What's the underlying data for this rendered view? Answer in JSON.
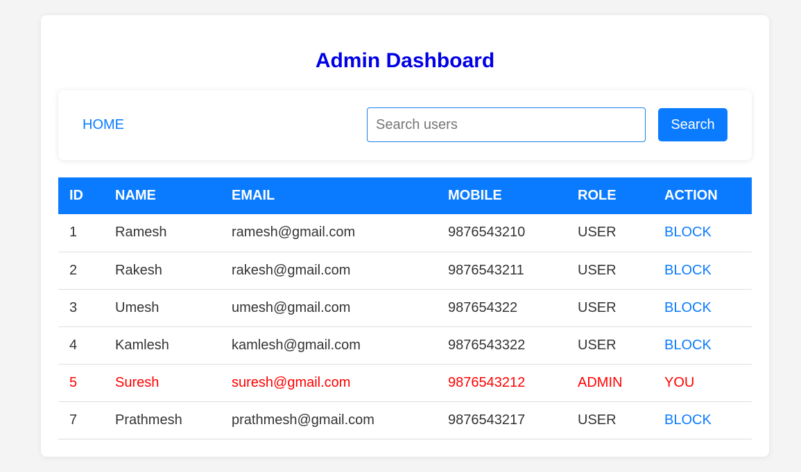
{
  "page": {
    "title": "Admin Dashboard"
  },
  "nav": {
    "home_label": "HOME",
    "search_placeholder": "Search users",
    "search_value": "",
    "search_button_label": "Search"
  },
  "table": {
    "headers": [
      "ID",
      "NAME",
      "EMAIL",
      "MOBILE",
      "ROLE",
      "ACTION"
    ],
    "rows": [
      {
        "id": "1",
        "name": "Ramesh",
        "email": "ramesh@gmail.com",
        "mobile": "9876543210",
        "role": "USER",
        "action": "BLOCK",
        "highlight": false
      },
      {
        "id": "2",
        "name": "Rakesh",
        "email": "rakesh@gmail.com",
        "mobile": "9876543211",
        "role": "USER",
        "action": "BLOCK",
        "highlight": false
      },
      {
        "id": "3",
        "name": "Umesh",
        "email": "umesh@gmail.com",
        "mobile": "987654322",
        "role": "USER",
        "action": "BLOCK",
        "highlight": false
      },
      {
        "id": "4",
        "name": "Kamlesh",
        "email": "kamlesh@gmail.com",
        "mobile": "9876543322",
        "role": "USER",
        "action": "BLOCK",
        "highlight": false
      },
      {
        "id": "5",
        "name": "Suresh",
        "email": "suresh@gmail.com",
        "mobile": "9876543212",
        "role": "ADMIN",
        "action": "YOU",
        "highlight": true
      },
      {
        "id": "7",
        "name": "Prathmesh",
        "email": "prathmesh@gmail.com",
        "mobile": "9876543217",
        "role": "USER",
        "action": "BLOCK",
        "highlight": false
      }
    ]
  },
  "colors": {
    "title": "#0000e6",
    "accent": "#0a7bff",
    "highlight": "#ff0000",
    "text": "#333333"
  }
}
